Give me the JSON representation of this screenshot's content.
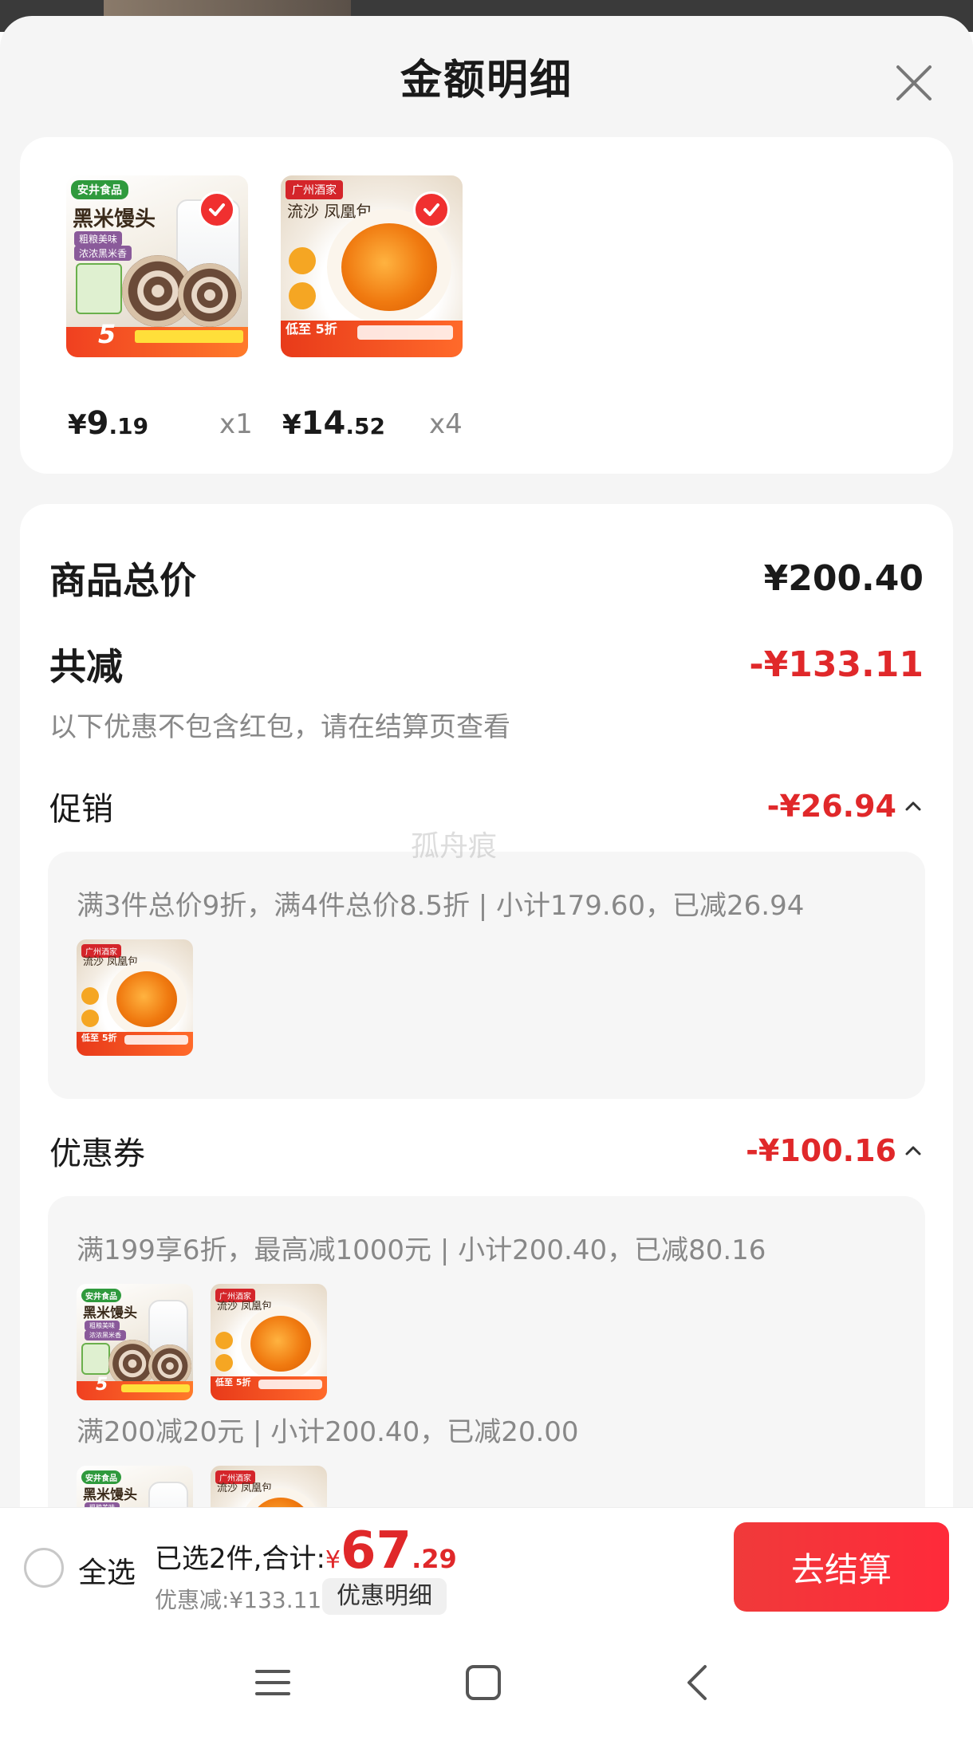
{
  "sheet": {
    "title": "金额明细",
    "close_icon": "close-icon"
  },
  "products": [
    {
      "name": "黑米馒头",
      "brand": "安井食品",
      "price_int": "9",
      "price_dec": ".19",
      "currency": "¥",
      "qty": "x1",
      "selected": true
    },
    {
      "name": "流沙凤凰包",
      "brand": "广州酒家",
      "price_int": "14",
      "price_dec": ".52",
      "currency": "¥",
      "qty": "x4",
      "selected": true
    }
  ],
  "thumb_text": {
    "bun_brand": "安井食品",
    "bun_title": "黑米馒头",
    "bun_sub1": "粗粮美味",
    "bun_sub2": "浓浓黑米香",
    "bun_five": "5",
    "custard_brand": "广州酒家",
    "custard_title": "流沙 凤凰包",
    "custard_low": "低至 5折"
  },
  "summary": {
    "total_label": "商品总价",
    "total_value": "¥200.40",
    "reduce_label": "共减",
    "reduce_value": "-¥133.11",
    "reduce_note": "以下优惠不包含红包，请在结算页查看"
  },
  "promo": {
    "label": "促销",
    "value": "-¥26.94",
    "rule": "满3件总价9折，满4件总价8.5折 | 小计179.60，已减26.94"
  },
  "coupon": {
    "label": "优惠券",
    "value": "-¥100.16",
    "rule1": "满199享6折，最高减1000元 | 小计200.40，已减80.16",
    "rule2": "满200减20元 | 小计200.40，已减20.00"
  },
  "watermark": "孤舟痕",
  "checkout": {
    "select_all": "全选",
    "selected_text": "已选2件,合计:",
    "currency": "¥",
    "total_int": "67",
    "total_dec": ".29",
    "discount_text": "优惠减:¥133.11",
    "detail_button": "优惠明细",
    "checkout_button": "去结算"
  },
  "colors": {
    "accent_red": "#e0282a",
    "button_red": "#f03a3a"
  },
  "nav": {
    "menu_icon": "menu-icon",
    "home_icon": "home-square-icon",
    "back_icon": "back-chevron-icon"
  }
}
